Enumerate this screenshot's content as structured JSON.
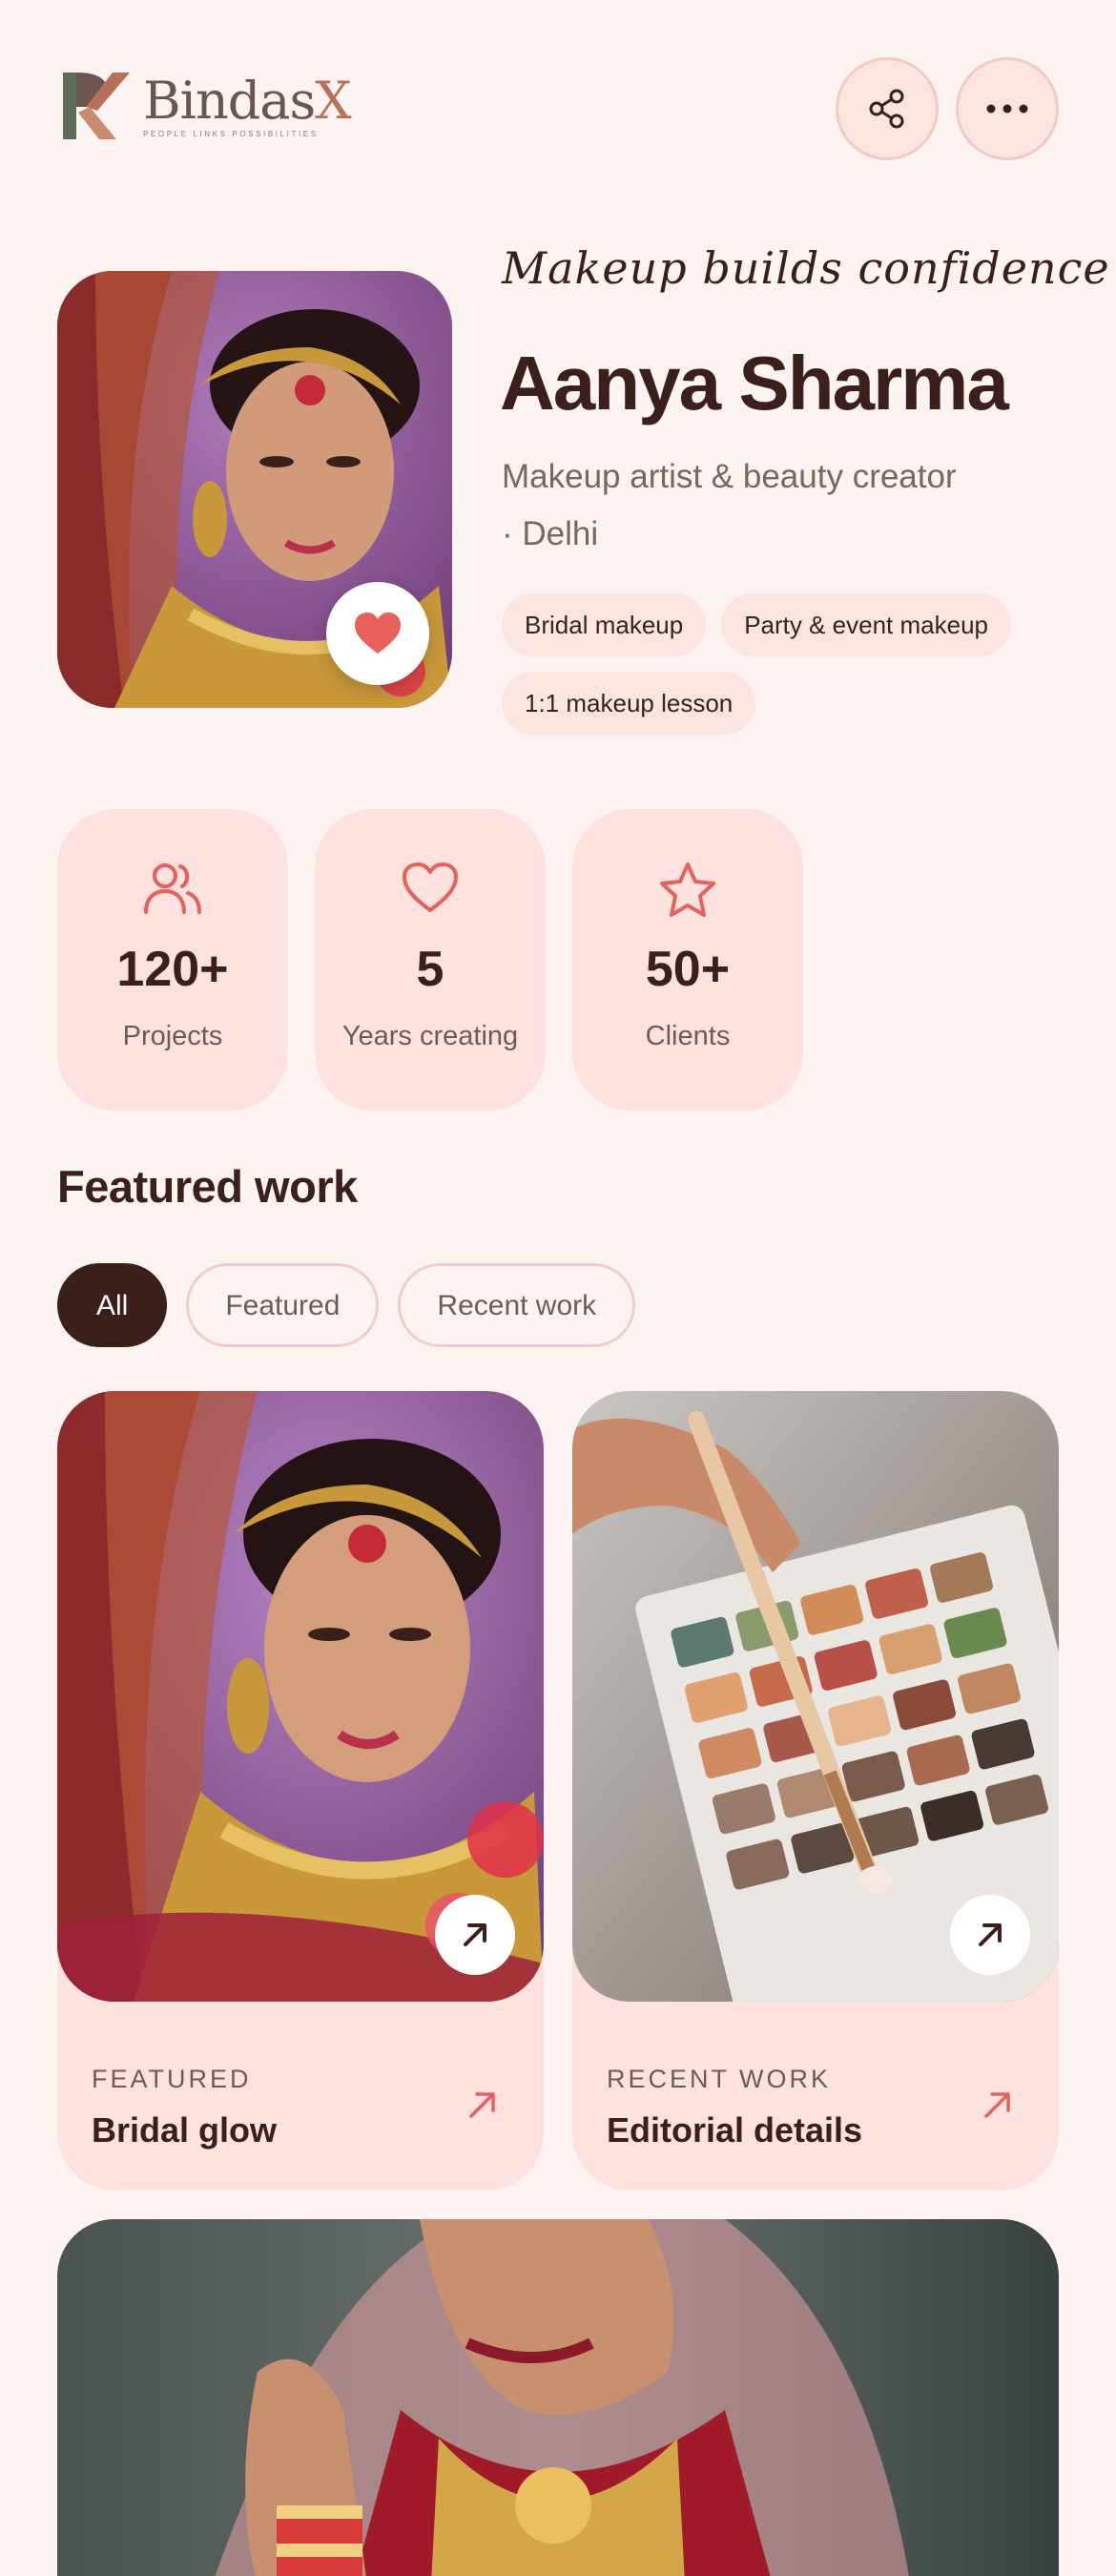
{
  "brand": {
    "name_main": "Bindas",
    "name_x": "X",
    "tagline": "PEOPLE  LINKS  POSSIBILITIES"
  },
  "header": {
    "share_icon": "share-icon",
    "more_icon": "more-icon"
  },
  "profile": {
    "tagline": "Makeup builds confidence",
    "name": "Aanya Sharma",
    "role": "Makeup artist & beauty creator",
    "location": "· Delhi",
    "tags": [
      "Bridal makeup",
      "Party & event makeup",
      "1:1 makeup lesson"
    ]
  },
  "stats": [
    {
      "icon": "users-icon",
      "value": "120+",
      "label": "Projects"
    },
    {
      "icon": "heart-icon",
      "value": "5",
      "label": "Years creating"
    },
    {
      "icon": "star-icon",
      "value": "50+",
      "label": "Clients"
    }
  ],
  "featured": {
    "title": "Featured work",
    "filters": [
      "All",
      "Featured",
      "Recent work"
    ],
    "active_filter": "All",
    "cards": [
      {
        "kicker": "FEATURED",
        "title": "Bridal glow"
      },
      {
        "kicker": "RECENT WORK",
        "title": "Editorial details"
      }
    ]
  },
  "colors": {
    "background": "#fdf4f2",
    "accent": "#e8605a",
    "dark": "#3b1f1a",
    "card": "#fde2e0"
  }
}
